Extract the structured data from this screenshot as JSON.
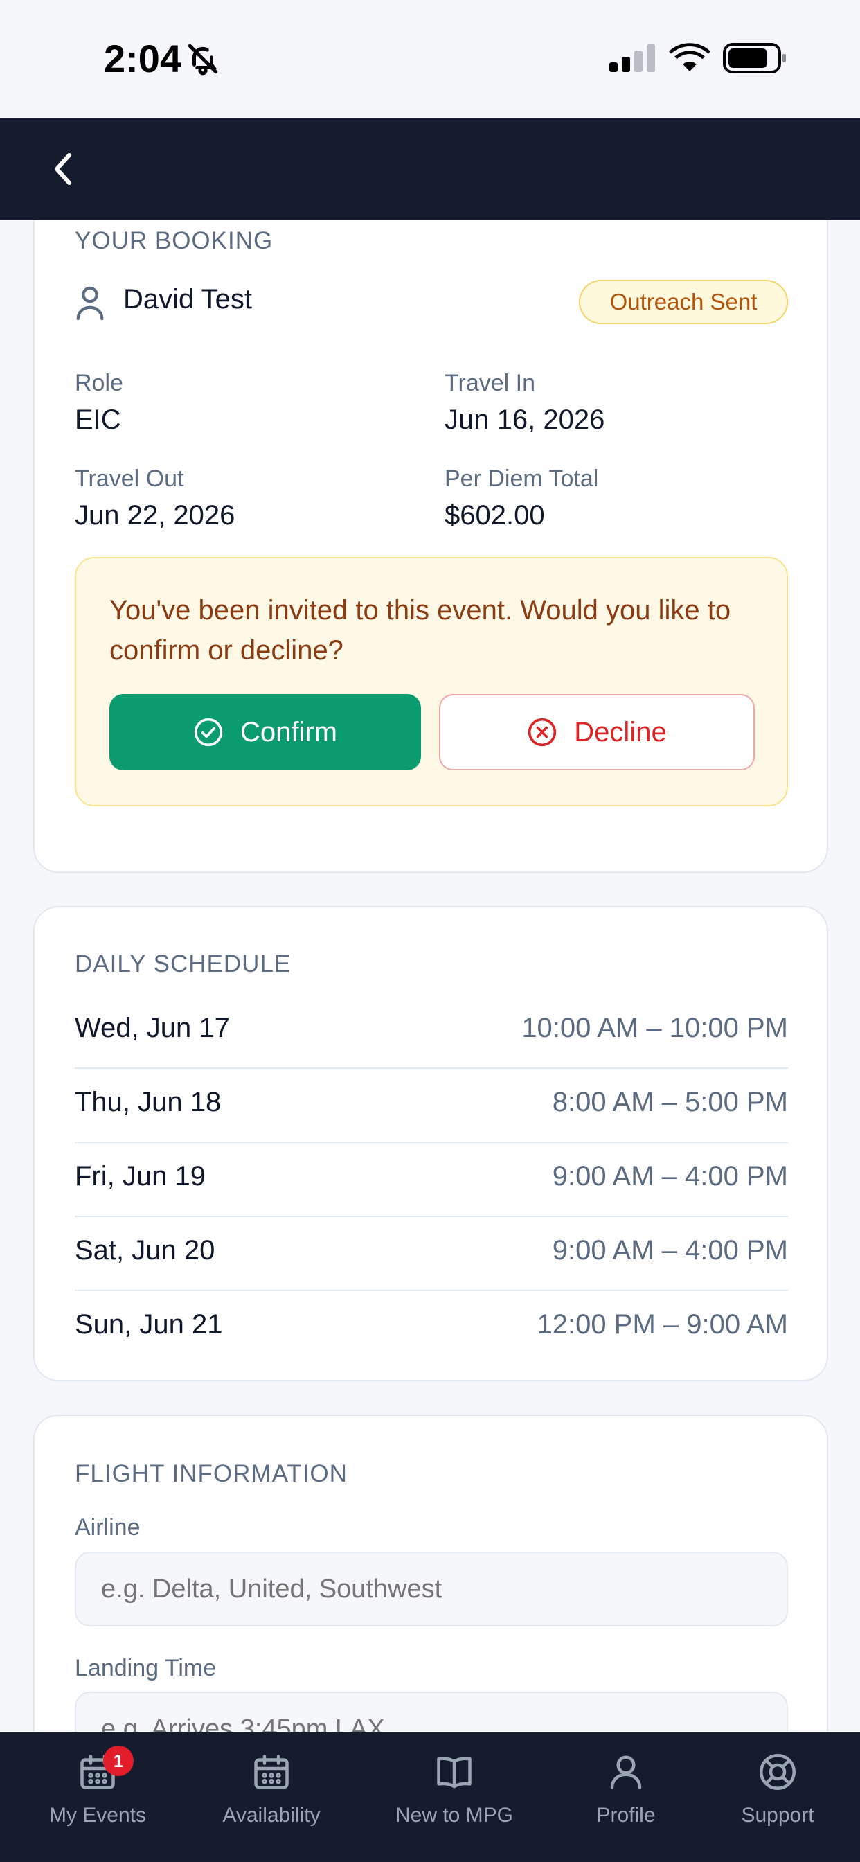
{
  "status_bar": {
    "time": "2:04"
  },
  "booking": {
    "section_title": "YOUR BOOKING",
    "person_name": "David Test",
    "status_badge": "Outreach Sent",
    "fields": {
      "role_label": "Role",
      "role_value": "EIC",
      "travel_in_label": "Travel In",
      "travel_in_value": "Jun 16, 2026",
      "travel_out_label": "Travel Out",
      "travel_out_value": "Jun 22, 2026",
      "per_diem_label": "Per Diem Total",
      "per_diem_value": "$602.00"
    },
    "invite_text": "You've been invited to this event. Would you like to confirm or decline?",
    "confirm_label": "Confirm",
    "decline_label": "Decline"
  },
  "schedule": {
    "section_title": "DAILY SCHEDULE",
    "rows": [
      {
        "day": "Wed, Jun 17",
        "time": "10:00 AM – 10:00 PM"
      },
      {
        "day": "Thu, Jun 18",
        "time": "8:00 AM – 5:00 PM"
      },
      {
        "day": "Fri, Jun 19",
        "time": "9:00 AM – 4:00 PM"
      },
      {
        "day": "Sat, Jun 20",
        "time": "9:00 AM – 4:00 PM"
      },
      {
        "day": "Sun, Jun 21",
        "time": "12:00 PM – 9:00 AM"
      }
    ]
  },
  "flight": {
    "section_title": "FLIGHT INFORMATION",
    "airline_label": "Airline",
    "airline_placeholder": "e.g. Delta, United, Southwest",
    "landing_label": "Landing Time",
    "landing_placeholder": "e.g. Arrives 3:45pm LAX"
  },
  "tab_bar": {
    "items": [
      {
        "label": "My Events",
        "icon": "calendar-icon",
        "badge": "1"
      },
      {
        "label": "Availability",
        "icon": "calendar-icon"
      },
      {
        "label": "New to MPG",
        "icon": "book-icon"
      },
      {
        "label": "Profile",
        "icon": "person-icon"
      },
      {
        "label": "Support",
        "icon": "lifebuoy-icon"
      }
    ]
  },
  "colors": {
    "header_bg": "#141c2e",
    "confirm": "#0a9b6e",
    "decline": "#dc2626",
    "badge_text": "#b45309",
    "notification_badge": "#e11d2a"
  }
}
